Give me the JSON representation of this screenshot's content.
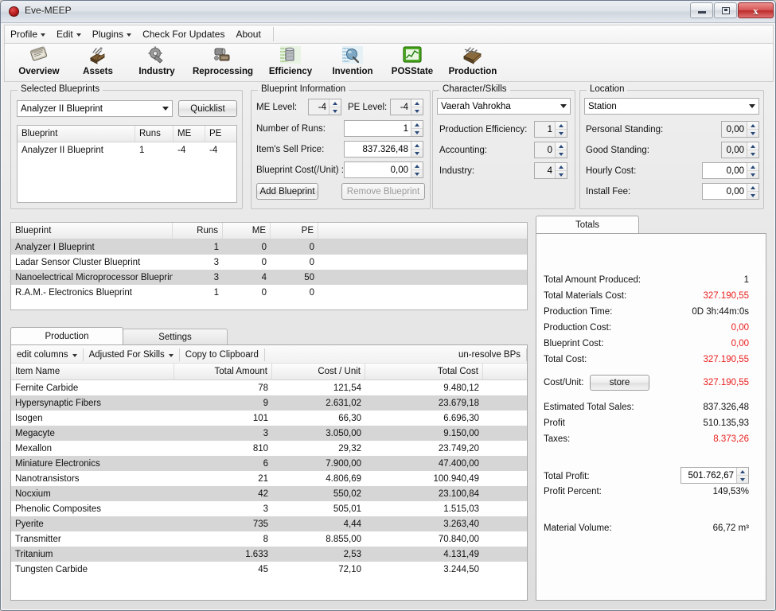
{
  "window": {
    "title": "Eve-MEEP",
    "icon": "app-circle-icon",
    "buttons": {
      "minimize": "–",
      "maximize": "▣",
      "close": "x"
    }
  },
  "menu": {
    "items": [
      {
        "label": "Profile",
        "has_arrow": true
      },
      {
        "label": "Edit",
        "has_arrow": true
      },
      {
        "label": "Plugins",
        "has_arrow": true
      },
      {
        "label": "Check For Updates",
        "has_arrow": false
      },
      {
        "label": "About",
        "has_arrow": false
      }
    ]
  },
  "toolbar": {
    "items": [
      {
        "label": "Overview",
        "icon": "overview-icon"
      },
      {
        "label": "Assets",
        "icon": "assets-icon"
      },
      {
        "label": "Industry",
        "icon": "industry-icon"
      },
      {
        "label": "Reprocessing",
        "icon": "reprocessing-icon"
      },
      {
        "label": "Efficiency",
        "icon": "efficiency-icon"
      },
      {
        "label": "Invention",
        "icon": "invention-icon"
      },
      {
        "label": "POSState",
        "icon": "posstate-icon"
      },
      {
        "label": "Production",
        "icon": "production-icon"
      }
    ]
  },
  "selected_blueprints": {
    "group_label": "Selected Blueprints",
    "combo_value": "Analyzer II Blueprint",
    "quicklist_label": "Quicklist",
    "columns": [
      "Blueprint",
      "Runs",
      "ME",
      "PE"
    ],
    "rows": [
      {
        "blueprint": "Analyzer II Blueprint",
        "runs": "1",
        "me": "-4",
        "pe": "-4"
      }
    ]
  },
  "blueprint_information": {
    "group_label": "Blueprint Information",
    "me_label": "ME Level:",
    "me_value": "-4",
    "pe_label": "PE Level:",
    "pe_value": "-4",
    "runs_label": "Number of Runs:",
    "runs_value": "1",
    "sell_price_label": "Item's Sell Price:",
    "sell_price_value": "837.326,48",
    "bp_cost_label": "Blueprint Cost(/Unit) :",
    "bp_cost_value": "0,00",
    "add_label": "Add Blueprint",
    "remove_label": "Remove Blueprint"
  },
  "character_skills": {
    "group_label": "Character/Skills",
    "character": "Vaerah Vahrokha",
    "prod_eff_label": "Production Efficiency:",
    "prod_eff_value": "1",
    "accounting_label": "Accounting:",
    "accounting_value": "0",
    "industry_label": "Industry:",
    "industry_value": "4"
  },
  "location": {
    "group_label": "Location",
    "location": "Station",
    "personal_standing_label": "Personal Standing:",
    "personal_standing_value": "0,00",
    "good_standing_label": "Good Standing:",
    "good_standing_value": "0,00",
    "hourly_cost_label": "Hourly Cost:",
    "hourly_cost_value": "0,00",
    "install_fee_label": "Install Fee:",
    "install_fee_value": "0,00"
  },
  "blueprint_list": {
    "columns": [
      "Blueprint",
      "Runs",
      "ME",
      "PE"
    ],
    "rows": [
      {
        "blueprint": "Analyzer I Blueprint",
        "runs": "1",
        "me": "0",
        "pe": "0",
        "alt": true
      },
      {
        "blueprint": "Ladar Sensor Cluster Blueprint",
        "runs": "3",
        "me": "0",
        "pe": "0",
        "alt": false
      },
      {
        "blueprint": "Nanoelectrical Microprocessor Blueprint",
        "runs": "3",
        "me": "4",
        "pe": "50",
        "alt": true
      },
      {
        "blueprint": "R.A.M.- Electronics Blueprint",
        "runs": "1",
        "me": "0",
        "pe": "0",
        "alt": false
      }
    ]
  },
  "production_panel": {
    "tabs": [
      {
        "label": "Production",
        "active": true
      },
      {
        "label": "Settings",
        "active": false
      }
    ],
    "commands": [
      {
        "label": "edit columns",
        "has_arrow": true
      },
      {
        "label": "Adjusted For Skills",
        "has_arrow": true
      },
      {
        "label": "Copy to Clipboard",
        "has_arrow": false
      }
    ],
    "right_command": "un-resolve BPs",
    "columns": [
      "Item Name",
      "Total Amount",
      "Cost / Unit",
      "Total Cost"
    ],
    "rows": [
      {
        "name": "Fernite Carbide",
        "amount": "78",
        "unit": "121,54",
        "total": "9.480,12",
        "alt": false
      },
      {
        "name": "Hypersynaptic Fibers",
        "amount": "9",
        "unit": "2.631,02",
        "total": "23.679,18",
        "alt": true
      },
      {
        "name": "Isogen",
        "amount": "101",
        "unit": "66,30",
        "total": "6.696,30",
        "alt": false
      },
      {
        "name": "Megacyte",
        "amount": "3",
        "unit": "3.050,00",
        "total": "9.150,00",
        "alt": true
      },
      {
        "name": "Mexallon",
        "amount": "810",
        "unit": "29,32",
        "total": "23.749,20",
        "alt": false
      },
      {
        "name": "Miniature Electronics",
        "amount": "6",
        "unit": "7.900,00",
        "total": "47.400,00",
        "alt": true
      },
      {
        "name": "Nanotransistors",
        "amount": "21",
        "unit": "4.806,69",
        "total": "100.940,49",
        "alt": false
      },
      {
        "name": "Nocxium",
        "amount": "42",
        "unit": "550,02",
        "total": "23.100,84",
        "alt": true
      },
      {
        "name": "Phenolic Composites",
        "amount": "3",
        "unit": "505,01",
        "total": "1.515,03",
        "alt": false
      },
      {
        "name": "Pyerite",
        "amount": "735",
        "unit": "4,44",
        "total": "3.263,40",
        "alt": true
      },
      {
        "name": "Transmitter",
        "amount": "8",
        "unit": "8.855,00",
        "total": "70.840,00",
        "alt": false
      },
      {
        "name": "Tritanium",
        "amount": "1.633",
        "unit": "2,53",
        "total": "4.131,49",
        "alt": true
      },
      {
        "name": "Tungsten Carbide",
        "amount": "45",
        "unit": "72,10",
        "total": "3.244,50",
        "alt": false
      }
    ]
  },
  "totals": {
    "tab_label": "Totals",
    "store_button": "store",
    "accent_red": "#e8201e",
    "rows": [
      {
        "label": "Total Amount Produced:",
        "value": "1",
        "red": false
      },
      {
        "label": "Total Materials Cost:",
        "value": "327.190,55",
        "red": true
      },
      {
        "label": "Production Time:",
        "value": "0D 3h:44m:0s",
        "red": false
      },
      {
        "label": "Production Cost:",
        "value": "0,00",
        "red": true
      },
      {
        "label": "Blueprint Cost:",
        "value": "0,00",
        "red": true
      },
      {
        "label": "Total Cost:",
        "value": "327.190,55",
        "red": true
      }
    ],
    "cost_unit_label": "Cost/Unit:",
    "cost_unit_value": "327.190,55",
    "sales_rows": [
      {
        "label": "Estimated Total Sales:",
        "value": "837.326,48",
        "red": false
      },
      {
        "label": "Profit",
        "value": "510.135,93",
        "red": false
      },
      {
        "label": "Taxes:",
        "value": "8.373,26",
        "red": true
      }
    ],
    "total_profit_label": "Total Profit:",
    "total_profit_value": "501.762,67",
    "profit_percent_label": "Profit Percent:",
    "profit_percent_value": "149,53%",
    "material_volume_label": "Material Volume:",
    "material_volume_value": "66,72 m³"
  }
}
